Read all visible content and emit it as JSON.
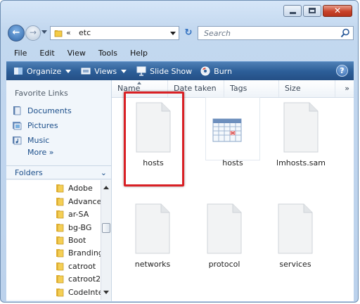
{
  "address": {
    "chevron": "«",
    "path": "etc"
  },
  "search": {
    "placeholder": "Search"
  },
  "menu": [
    "File",
    "Edit",
    "View",
    "Tools",
    "Help"
  ],
  "toolbar": {
    "organize": "Organize",
    "views": "Views",
    "slideshow": "Slide Show",
    "burn": "Burn",
    "help": "?"
  },
  "favorites": {
    "title": "Favorite Links",
    "items": [
      "Documents",
      "Pictures",
      "Music"
    ],
    "more": "More",
    "more_arrow": "»"
  },
  "folders": {
    "label": "Folders",
    "tree": [
      "Adobe",
      "Advance",
      "ar-SA",
      "bg-BG",
      "Boot",
      "Branding",
      "catroot",
      "catroot2",
      "CodeInte"
    ]
  },
  "columns": [
    "Name",
    "Date taken",
    "Tags",
    "Size"
  ],
  "columns_more": "»",
  "files": [
    "hosts",
    "hosts",
    "lmhosts.sam",
    "networks",
    "protocol",
    "services"
  ],
  "colors": {
    "toolbar": "#2d5f99",
    "highlight": "#d92025",
    "link": "#1b4e8a"
  }
}
